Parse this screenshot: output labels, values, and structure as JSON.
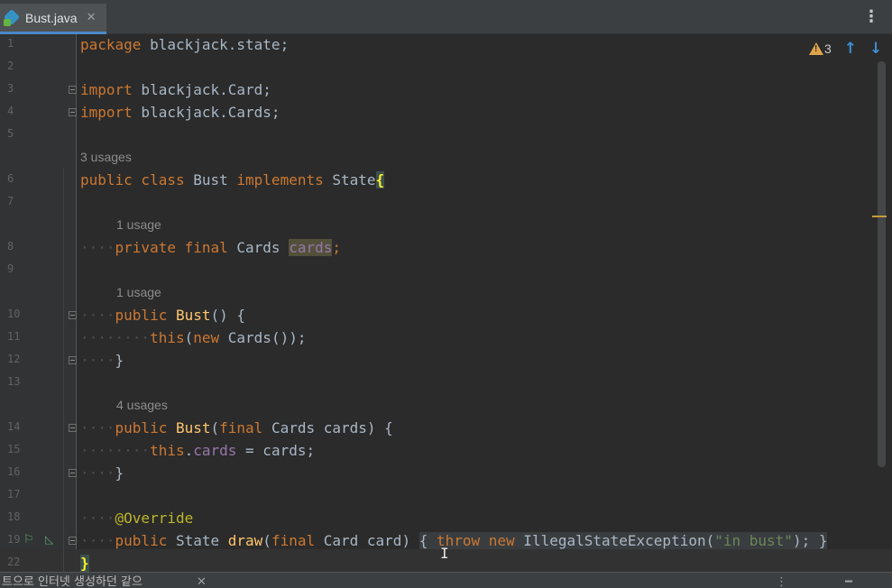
{
  "tab": {
    "filename": "Bust.java",
    "close": "✕"
  },
  "toolbar": {
    "menu": "⋮"
  },
  "inspection": {
    "warnings": "3",
    "up": "↑",
    "down": "↓"
  },
  "hints": {
    "h5": "3 usages",
    "h7": "1 usage",
    "h9": "1 usage",
    "h13": "4 usages"
  },
  "lines": [
    {
      "n": "1"
    },
    {
      "n": "2"
    },
    {
      "n": "3"
    },
    {
      "n": "4"
    },
    {
      "n": "5"
    },
    {
      "n": "6"
    },
    {
      "n": "7"
    },
    {
      "n": "8"
    },
    {
      "n": "9"
    },
    {
      "n": "10"
    },
    {
      "n": "11"
    },
    {
      "n": "12"
    },
    {
      "n": "13"
    },
    {
      "n": "14"
    },
    {
      "n": "15"
    },
    {
      "n": "16"
    },
    {
      "n": "17"
    },
    {
      "n": "18"
    },
    {
      "n": "19"
    },
    {
      "n": "22"
    }
  ],
  "code": {
    "package_kw": "package",
    "package_name": " blackjack.state;",
    "import_kw": "import",
    "import1": " blackjack.Card;",
    "import2": " blackjack.Cards;",
    "l6_public": "public",
    "l6_class": " class",
    "l6_name": " Bust",
    "l6_impl": " implements",
    "l6_state": " State",
    "l6_brace": "{",
    "l8_dots": "····",
    "l8_private": "private",
    "l8_final": " final",
    "l8_type": " Cards ",
    "l8_field": "cards",
    "l8_semi": ";",
    "l10_public": "public",
    "l10_name": " Bust",
    "l10_rest": "() {",
    "l11_dots": "········",
    "l11_this": "this",
    "l11_paren": "(",
    "l11_new": "new",
    "l11_rest": " Cards());",
    "l12_close": "}",
    "l14_public": "public",
    "l14_name": " Bust",
    "l14_paren": "(",
    "l14_final": "final",
    "l14_rest": " Cards cards) {",
    "l15_this": "this",
    "l15_dot": ".",
    "l15_field": "cards",
    "l15_rest": " = cards;",
    "l16_close": "}",
    "l18_ann": "@Override",
    "l19_public": "public",
    "l19_type": " State ",
    "l19_fn": "draw",
    "l19_paren": "(",
    "l19_final": "final",
    "l19_params": " Card card) ",
    "l19_open": "{ ",
    "l19_throw": "throw",
    "l19_new": " new",
    "l19_exc": " IllegalStateException(",
    "l19_str": "\"in bust\"",
    "l19_end": ");",
    "l19_close": " }",
    "l22_brace": "}"
  },
  "status": {
    "text": "트으로 인터넷 생성하던 같으",
    "close": "✕",
    "right": "⋮ ━"
  }
}
